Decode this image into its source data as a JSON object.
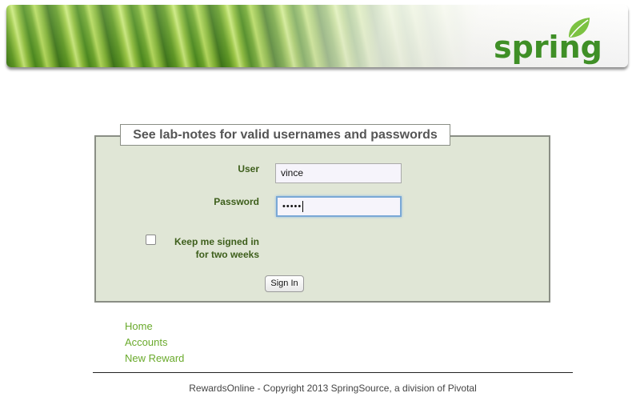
{
  "header": {
    "logo_text": "spring",
    "brand_color": "#3f8f26"
  },
  "login": {
    "legend": "See lab-notes for valid usernames and passwords",
    "user_label": "User",
    "user_value": "vince",
    "password_label": "Password",
    "password_mask": "•••••",
    "remember_label": "Keep me signed in for two weeks",
    "remember_checked": false,
    "signin_label": "Sign In",
    "panel_color": "#e0e6d6"
  },
  "nav": {
    "links": [
      "Home",
      "Accounts",
      "New Reward"
    ],
    "link_color": "#6aaa2c"
  },
  "footer": {
    "text": "RewardsOnline - Copyright 2013 SpringSource, a division of Pivotal"
  }
}
